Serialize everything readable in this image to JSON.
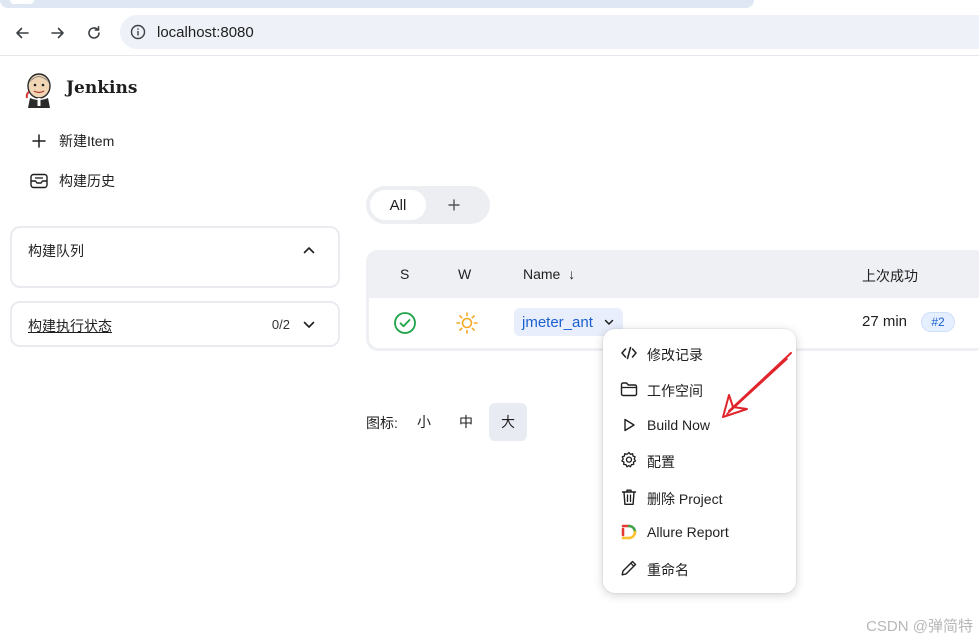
{
  "browser": {
    "url": "localhost:8080"
  },
  "header": {
    "brand": "Jenkins"
  },
  "sidebar": {
    "tasks": [
      {
        "label": "新建Item",
        "icon": "plus-icon"
      },
      {
        "label": "构建历史",
        "icon": "inbox-icon"
      }
    ],
    "build_queue": {
      "title": "构建队列"
    },
    "executor_status": {
      "title": "构建执行状态",
      "count": "0/2"
    }
  },
  "view_tabs": {
    "all_label": "All",
    "add_label": "+"
  },
  "job_table": {
    "headers": {
      "status": "S",
      "weather": "W",
      "name": "Name",
      "sort_indicator": "↓",
      "last_success": "上次成功"
    },
    "rows": [
      {
        "status": "success",
        "weather": "sunny",
        "name": "jmeter_ant",
        "last_success": "27 min",
        "build": "#2"
      }
    ]
  },
  "icon_size": {
    "label": "图标:",
    "options": [
      "小",
      "中",
      "大"
    ],
    "selected": "大"
  },
  "job_menu": {
    "items": [
      {
        "label": "修改记录",
        "icon": "code-icon"
      },
      {
        "label": "工作空间",
        "icon": "folder-icon"
      },
      {
        "label": "Build Now",
        "icon": "play-icon"
      },
      {
        "label": "配置",
        "icon": "gear-icon"
      },
      {
        "label": "删除 Project",
        "icon": "trash-icon"
      },
      {
        "label": "Allure Report",
        "icon": "allure-icon"
      },
      {
        "label": "重命名",
        "icon": "pencil-icon"
      }
    ]
  },
  "annotation": {
    "arrow_color": "#e0242b"
  },
  "watermark": "CSDN @弹简特",
  "colors": {
    "link": "#1a5fd0",
    "success": "#1ea446",
    "weather": "#f5a623",
    "omnibox": "#eef1f8"
  }
}
